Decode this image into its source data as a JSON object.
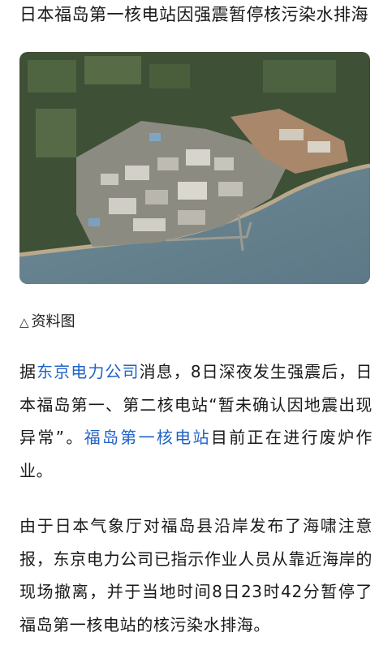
{
  "article": {
    "headline": "日本福岛第一核电站因强震暂停核污染水排海",
    "image_caption": "资料图",
    "caption_icon": "triangle-outline-icon",
    "paragraph1": {
      "part1": "据",
      "link1": "东京电力公司",
      "part2": "消息，8日深夜发生强震后，日本福岛第一、第二核电站“暂未确认因地震出现异常”。",
      "link2": "福岛第一核电站",
      "part3": "目前正在进行废炉作业。"
    },
    "paragraph2": "由于日本气象厅对福岛县沿岸发布了海啸注意报，东京电力公司已指示作业人员从靠近海岸的现场撤离，并于当地时间8日23时42分暂停了福岛第一核电站的核污染水排海。"
  },
  "colors": {
    "link": "#1f62c8",
    "text": "#1a1a1a"
  }
}
